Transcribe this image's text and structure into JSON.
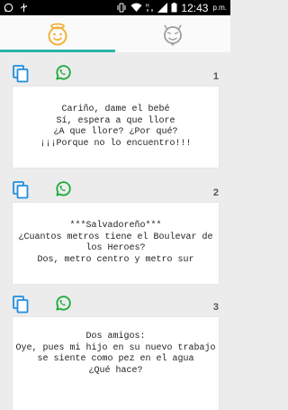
{
  "status_bar": {
    "time": "12:43",
    "ampm": "p.m.",
    "icons": [
      "whatsapp-icon",
      "usb-icon",
      "vibrate-icon",
      "wifi-icon",
      "hd-icon",
      "signal-icon",
      "battery-icon"
    ]
  },
  "tabs": [
    {
      "name": "angel-tab",
      "icon": "angel-face-icon",
      "active": true
    },
    {
      "name": "devil-tab",
      "icon": "devil-face-icon",
      "active": false
    }
  ],
  "colors": {
    "accent": "#2bb5a5",
    "copy_icon": "#1f8fe0",
    "whatsapp_icon": "#1aab3a",
    "tab_angel": "#f2b13a",
    "tab_devil": "#9e9e9e"
  },
  "jokes": [
    {
      "number": "1",
      "text": "Cariño, dame el bebé\nSí, espera a que llore\n¿A que llore? ¿Por qué?\n¡¡¡Porque no lo encuentro!!!"
    },
    {
      "number": "2",
      "text": "***Salvadoreño***\n¿Cuantos metros tiene el Boulevar de los Heroes?\nDos, metro centro y metro sur"
    },
    {
      "number": "3",
      "text": "Dos amigos:\nOye, pues mi hijo en su nuevo trabajo se siente como pez en el agua\n¿Qué hace?"
    }
  ]
}
